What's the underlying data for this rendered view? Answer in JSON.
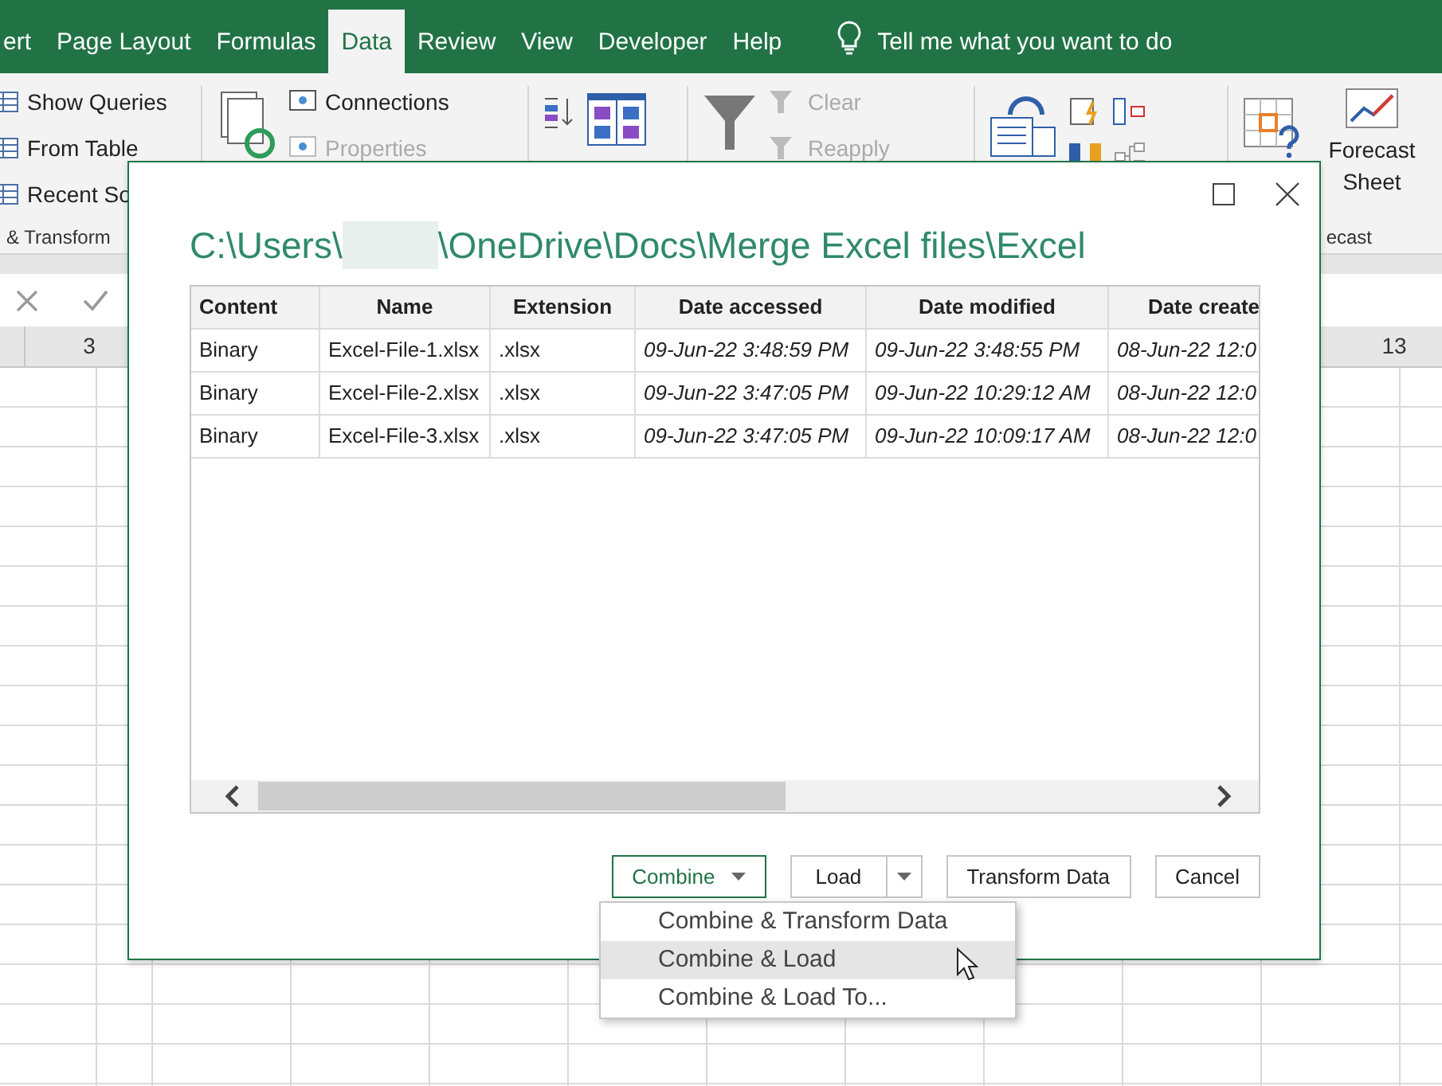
{
  "ribbon_tabs": [
    {
      "label": "ert",
      "selected": false
    },
    {
      "label": "Page Layout",
      "selected": false
    },
    {
      "label": "Formulas",
      "selected": false
    },
    {
      "label": "Data",
      "selected": true
    },
    {
      "label": "Review",
      "selected": false
    },
    {
      "label": "View",
      "selected": false
    },
    {
      "label": "Developer",
      "selected": false
    },
    {
      "label": "Help",
      "selected": false
    }
  ],
  "tell_me": "Tell me what you want to do",
  "get_transform": {
    "commands": [
      {
        "label": "Show Queries",
        "disabled": false
      },
      {
        "label": "From Table",
        "disabled": false
      },
      {
        "label": "Recent So",
        "disabled": false
      }
    ],
    "group_label": "& Transform"
  },
  "connections": [
    {
      "label": "Connections",
      "disabled": false
    },
    {
      "label": "Properties",
      "disabled": true
    }
  ],
  "filter_commands": [
    {
      "label": "Clear",
      "disabled": true
    },
    {
      "label": "Reapply",
      "disabled": true
    }
  ],
  "forecast": {
    "button": "Forecast Sheet",
    "group_label": "ecast"
  },
  "column_headers": [
    "3",
    "13"
  ],
  "dialog": {
    "path_start": "C:\\Users\\",
    "path_end": "\\OneDrive\\Docs\\Merge Excel files\\Excel",
    "columns": [
      "Content",
      "Name",
      "Extension",
      "Date accessed",
      "Date modified",
      "Date create"
    ],
    "rows": [
      {
        "cells": [
          "Binary",
          "Excel-File-1.xlsx",
          ".xlsx",
          "09-Jun-22 3:48:59 PM",
          "09-Jun-22 3:48:55 PM",
          "08-Jun-22 12:0"
        ]
      },
      {
        "cells": [
          "Binary",
          "Excel-File-2.xlsx",
          ".xlsx",
          "09-Jun-22 3:47:05 PM",
          "09-Jun-22 10:29:12 AM",
          "08-Jun-22 12:0"
        ]
      },
      {
        "cells": [
          "Binary",
          "Excel-File-3.xlsx",
          ".xlsx",
          "09-Jun-22 3:47:05 PM",
          "09-Jun-22 10:09:17 AM",
          "08-Jun-22 12:0"
        ]
      }
    ],
    "buttons": [
      {
        "label": "Combine",
        "kind": "dropdown",
        "focused": true
      },
      {
        "label": "Load",
        "kind": "split",
        "focused": false
      },
      {
        "label": "Transform Data",
        "kind": "plain",
        "focused": false
      },
      {
        "label": "Cancel",
        "kind": "plain",
        "focused": false
      }
    ],
    "menu": [
      {
        "label": "Combine & Transform Data",
        "highlighted": false
      },
      {
        "label": "Combine & Load",
        "highlighted": true
      },
      {
        "label": "Combine & Load To...",
        "highlighted": false
      }
    ]
  }
}
